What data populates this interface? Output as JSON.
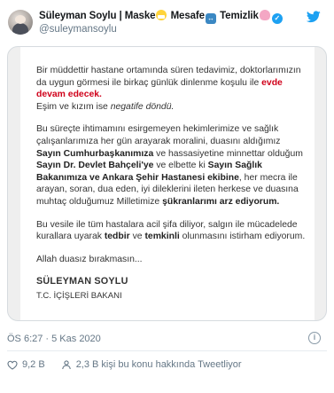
{
  "tweet": {
    "display_name": "Süleyman Soylu",
    "name_separator": "|",
    "name_words": [
      "Maske",
      "Mesafe",
      "Temizlik"
    ],
    "handle": "@suleymansoylu",
    "timestamp": "ÖS 6:27 · 5 Kas 2020",
    "likes": "9,2 B",
    "talking": "2,3 B kişi bu konu hakkında Tweetliyor"
  },
  "document": {
    "p1_line": "Bir müddettir hastane ortamında süren tedavimiz, doktorlarımızın da uygun görmesi ile birkaç günlük dinlenme koşulu ile",
    "p1_highlight": "evde devam edecek.",
    "p1_line2a": "Eşim ve kızım ise",
    "p1_line2b": "negatife döndü.",
    "p2_a": "Bu süreçte ihtimamını esirgemeyen hekimlerimize ve sağlık çalışanlarımıza her gün arayarak moralini, duasını aldığımız",
    "p2_b": "Sayın Cumhurbaşkanımıza",
    "p2_c": "ve hassasiyetine minnettar olduğum",
    "p2_d": "Sayın Dr. Devlet Bahçeli'ye",
    "p2_e": "ve elbette ki",
    "p2_f": "Sayın Sağlık Bakanımıza ve Ankara Şehir Hastanesi ekibine",
    "p2_g": ", her mecra ile arayan, soran, dua eden, iyi dileklerini ileten herkese ve duasına muhtaç olduğumuz Milletimize",
    "p2_h": "şükranlarımı arz ediyorum.",
    "p3_a": "Bu vesile ile tüm hastalara acil şifa diliyor, salgın ile mücadelede kurallara uyarak",
    "p3_b": "tedbir",
    "p3_c": "ve",
    "p3_d": "temkinli",
    "p3_e": "olunmasını istirham ediyorum.",
    "p4": "Allah duasız bırakmasın...",
    "signature_name": "SÜLEYMAN SOYLU",
    "signature_title": "T.C. İÇİŞLERİ BAKANI"
  }
}
